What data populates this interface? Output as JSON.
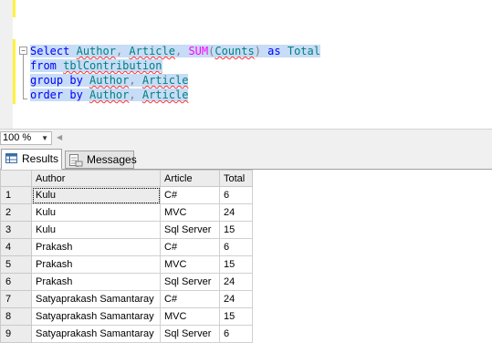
{
  "editor": {
    "lines": [
      [
        {
          "t": "Select",
          "c": "kw"
        },
        {
          "t": " ",
          "c": ""
        },
        {
          "t": "Author",
          "c": "ob sq"
        },
        {
          "t": ", ",
          "c": "gr"
        },
        {
          "t": "Article",
          "c": "ob sq"
        },
        {
          "t": ", ",
          "c": "gr"
        },
        {
          "t": "SUM",
          "c": "fn"
        },
        {
          "t": "(",
          "c": "gr"
        },
        {
          "t": "Counts",
          "c": "ob sq"
        },
        {
          "t": ")",
          "c": "gr"
        },
        {
          "t": " as ",
          "c": "kw"
        },
        {
          "t": "Total",
          "c": "ob"
        }
      ],
      [
        {
          "t": "from",
          "c": "kw"
        },
        {
          "t": " ",
          "c": ""
        },
        {
          "t": "tblContribution",
          "c": "ob sq"
        }
      ],
      [
        {
          "t": "group by",
          "c": "kw"
        },
        {
          "t": " ",
          "c": ""
        },
        {
          "t": "Author",
          "c": "ob sq"
        },
        {
          "t": ", ",
          "c": "gr"
        },
        {
          "t": "Article",
          "c": "ob sq"
        }
      ],
      [
        {
          "t": "order by",
          "c": "kw"
        },
        {
          "t": " ",
          "c": ""
        },
        {
          "t": "Author",
          "c": "ob sq"
        },
        {
          "t": ", ",
          "c": "gr"
        },
        {
          "t": "Article",
          "c": "ob sq"
        }
      ]
    ]
  },
  "zoom": {
    "value": "100 %"
  },
  "tabs": {
    "results": "Results",
    "messages": "Messages"
  },
  "grid": {
    "columns": [
      "Author",
      "Article",
      "Total"
    ],
    "rows": [
      {
        "n": "1",
        "author": "Kulu",
        "article": "C#",
        "total": "6"
      },
      {
        "n": "2",
        "author": "Kulu",
        "article": "MVC",
        "total": "24"
      },
      {
        "n": "3",
        "author": "Kulu",
        "article": "Sql Server",
        "total": "15"
      },
      {
        "n": "4",
        "author": "Prakash",
        "article": "C#",
        "total": "6"
      },
      {
        "n": "5",
        "author": "Prakash",
        "article": "MVC",
        "total": "15"
      },
      {
        "n": "6",
        "author": "Prakash",
        "article": "Sql Server",
        "total": "24"
      },
      {
        "n": "7",
        "author": "Satyaprakash Samantaray",
        "article": "C#",
        "total": "24"
      },
      {
        "n": "8",
        "author": "Satyaprakash Samantaray",
        "article": "MVC",
        "total": "15"
      },
      {
        "n": "9",
        "author": "Satyaprakash Samantaray",
        "article": "Sql Server",
        "total": "6"
      }
    ]
  },
  "colors": {
    "selection": "#c7dcf6",
    "keyword": "#0000ff",
    "function": "#ff00ff",
    "object": "#008080",
    "change_bar": "#fdf23d"
  }
}
